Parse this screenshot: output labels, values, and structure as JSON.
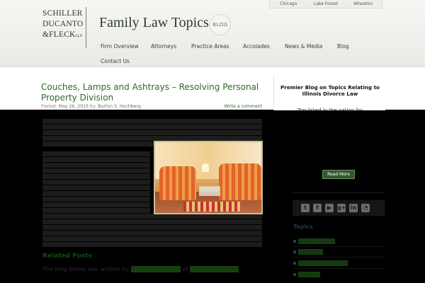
{
  "header": {
    "logo_lines": [
      "SCHILLER",
      "DUCANTO",
      "&FLECK"
    ],
    "logo_suffix": "LLP",
    "site_title": "Family Law Topics",
    "blog_badge": "BLOG",
    "locations": [
      "Chicago",
      "Lake Forest",
      "Wheaton"
    ],
    "nav": [
      "Firm Overview",
      "Attorneys",
      "Practice Areas",
      "Accolades",
      "News & Media",
      "Blog",
      "Contact Us"
    ]
  },
  "post": {
    "title": "Couches, Lamps and Ashtrays – Resolving Personal Property Division",
    "posted_label": "Posted:",
    "date": "May 26, 2015",
    "by_label": "by:",
    "author": "Burton S. Hochberg",
    "comment_link": "Write a comment",
    "quick_heading": "Related Posts",
    "quick_text_1": "The blog below was written by",
    "quick_link_1": "Burton Hochberg",
    "quick_text_2": "of",
    "quick_link_2": "Schiller DuCanto"
  },
  "sidebar": {
    "heading": "Premier Blog on Topics Relating to Illinois Divorce Law",
    "subtext": "Top-listed in the nation for",
    "read_more": "Read More",
    "social_icons": [
      "twitter-icon",
      "facebook-icon",
      "youtube-icon",
      "google-plus-icon",
      "linkedin-icon",
      "rss-icon"
    ],
    "social_glyphs": [
      "t",
      "f",
      "▶",
      "g+",
      "in",
      "◔"
    ],
    "topics_heading": "Topics",
    "topics": [
      "Child Custody",
      "Adoption",
      "Divorce & Children",
      "Divorce"
    ]
  },
  "colors": {
    "accent_green": "#2d6b26",
    "header_bg": "#efefec",
    "button_green": "#315a2c"
  }
}
